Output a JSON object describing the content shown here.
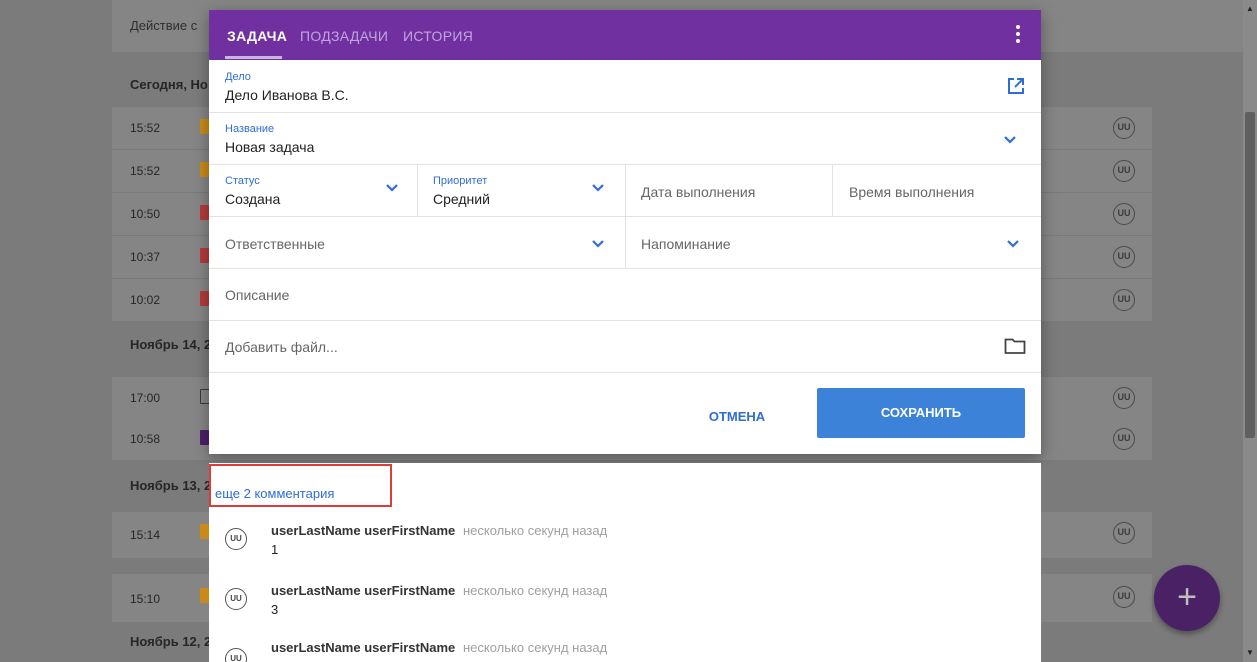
{
  "background": {
    "header_text": "Действие с",
    "sections": [
      {
        "label": "Сегодня, Но",
        "rows": [
          {
            "time": "15:52",
            "flag_color": "#c98a17",
            "avatar": "UU"
          },
          {
            "time": "15:52",
            "flag_color": "#c98a17",
            "avatar": "UU"
          },
          {
            "time": "10:50",
            "flag_color": "#b53a3a",
            "avatar": "UU"
          },
          {
            "time": "10:37",
            "flag_color": "#b53a3a",
            "avatar": "UU"
          },
          {
            "time": "10:02",
            "flag_color": "#b53a3a",
            "avatar": "UU"
          }
        ]
      },
      {
        "label": "Ноябрь 14, 2",
        "rows": [
          {
            "time": "17:00",
            "flag_color": "outline",
            "avatar": "UU"
          },
          {
            "time": "10:58",
            "flag_color": "#4b2166",
            "avatar": "UU"
          }
        ]
      },
      {
        "label": "Ноябрь 13, 2",
        "rows": [
          {
            "time": "15:14",
            "flag_color": "#c98a17",
            "avatar": "UU"
          },
          {
            "time": "15:10",
            "flag_color": "#c98a17",
            "avatar": "UU"
          }
        ]
      },
      {
        "label": "Ноябрь 12, 2",
        "rows": []
      }
    ],
    "fab_label": "+"
  },
  "dialog": {
    "tabs": [
      "ЗАДАЧА",
      "ПОДЗАДАЧИ",
      "ИСТОРИЯ"
    ],
    "active_tab": 0,
    "case": {
      "label": "Дело",
      "value": "Дело Иванова В.С."
    },
    "name": {
      "label": "Название",
      "value": "Новая задача"
    },
    "status": {
      "label": "Статус",
      "value": "Создана"
    },
    "priority": {
      "label": "Приоритет",
      "value": "Средний"
    },
    "due_date": {
      "placeholder": "Дата выполнения"
    },
    "due_time": {
      "placeholder": "Время выполнения"
    },
    "assignees": {
      "placeholder": "Ответственные"
    },
    "reminder": {
      "placeholder": "Напоминание"
    },
    "description": {
      "placeholder": "Описание"
    },
    "attach": {
      "placeholder": "Добавить файл..."
    },
    "cancel_label": "ОТМЕНА",
    "save_label": "СОХРАНИТЬ",
    "accent_color": "#7030a0",
    "button_color": "#3b82d8"
  },
  "comments": {
    "more_link": "еще 2 комментария",
    "items": [
      {
        "avatar": "UU",
        "author": "userLastName userFirstName",
        "ago": "несколько секунд назад",
        "text": "1"
      },
      {
        "avatar": "UU",
        "author": "userLastName userFirstName",
        "ago": "несколько секунд назад",
        "text": "3"
      },
      {
        "avatar": "UU",
        "author": "userLastName userFirstName",
        "ago": "несколько секунд назад",
        "text": ""
      }
    ]
  }
}
